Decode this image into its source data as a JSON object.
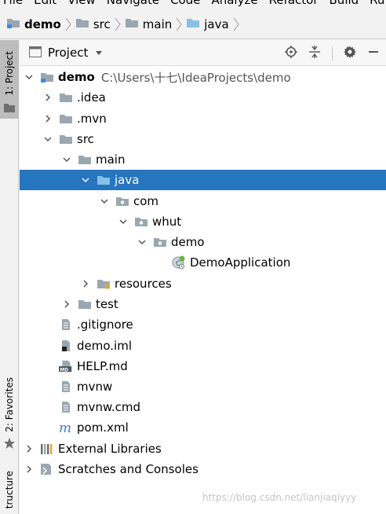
{
  "menubar": {
    "items": [
      "File",
      "Edit",
      "View",
      "Navigate",
      "Code",
      "Analyze",
      "Refactor",
      "Build",
      "Ru"
    ]
  },
  "breadcrumb": [
    "demo",
    "src",
    "main",
    "java"
  ],
  "left_tabs": {
    "project": "1: Project",
    "favorites": "2: Favorites",
    "structure": "tructure"
  },
  "panel": {
    "title": "Project"
  },
  "tree": {
    "root_name": "demo",
    "root_path": "C:\\Users\\十七\\IdeaProjects\\demo",
    "idea": ".idea",
    "mvn": ".mvn",
    "src": "src",
    "main": "main",
    "java": "java",
    "com": "com",
    "whut": "whut",
    "demo_pkg": "demo",
    "demo_app": "DemoApplication",
    "resources": "resources",
    "test": "test",
    "gitignore": ".gitignore",
    "demo_iml": "demo.iml",
    "help_md": "HELP.md",
    "mvnw": "mvnw",
    "mvnw_cmd": "mvnw.cmd",
    "pom": "pom.xml",
    "ext_libs": "External Libraries",
    "scratches": "Scratches and Consoles"
  },
  "watermark": "https://blog.csdn.net/lianjiaqiyyy",
  "colors": {
    "selection": "#2675bf",
    "folder": "#9aa7b0",
    "source_folder": "#87c1e6",
    "maven": "#3b7fd6"
  }
}
